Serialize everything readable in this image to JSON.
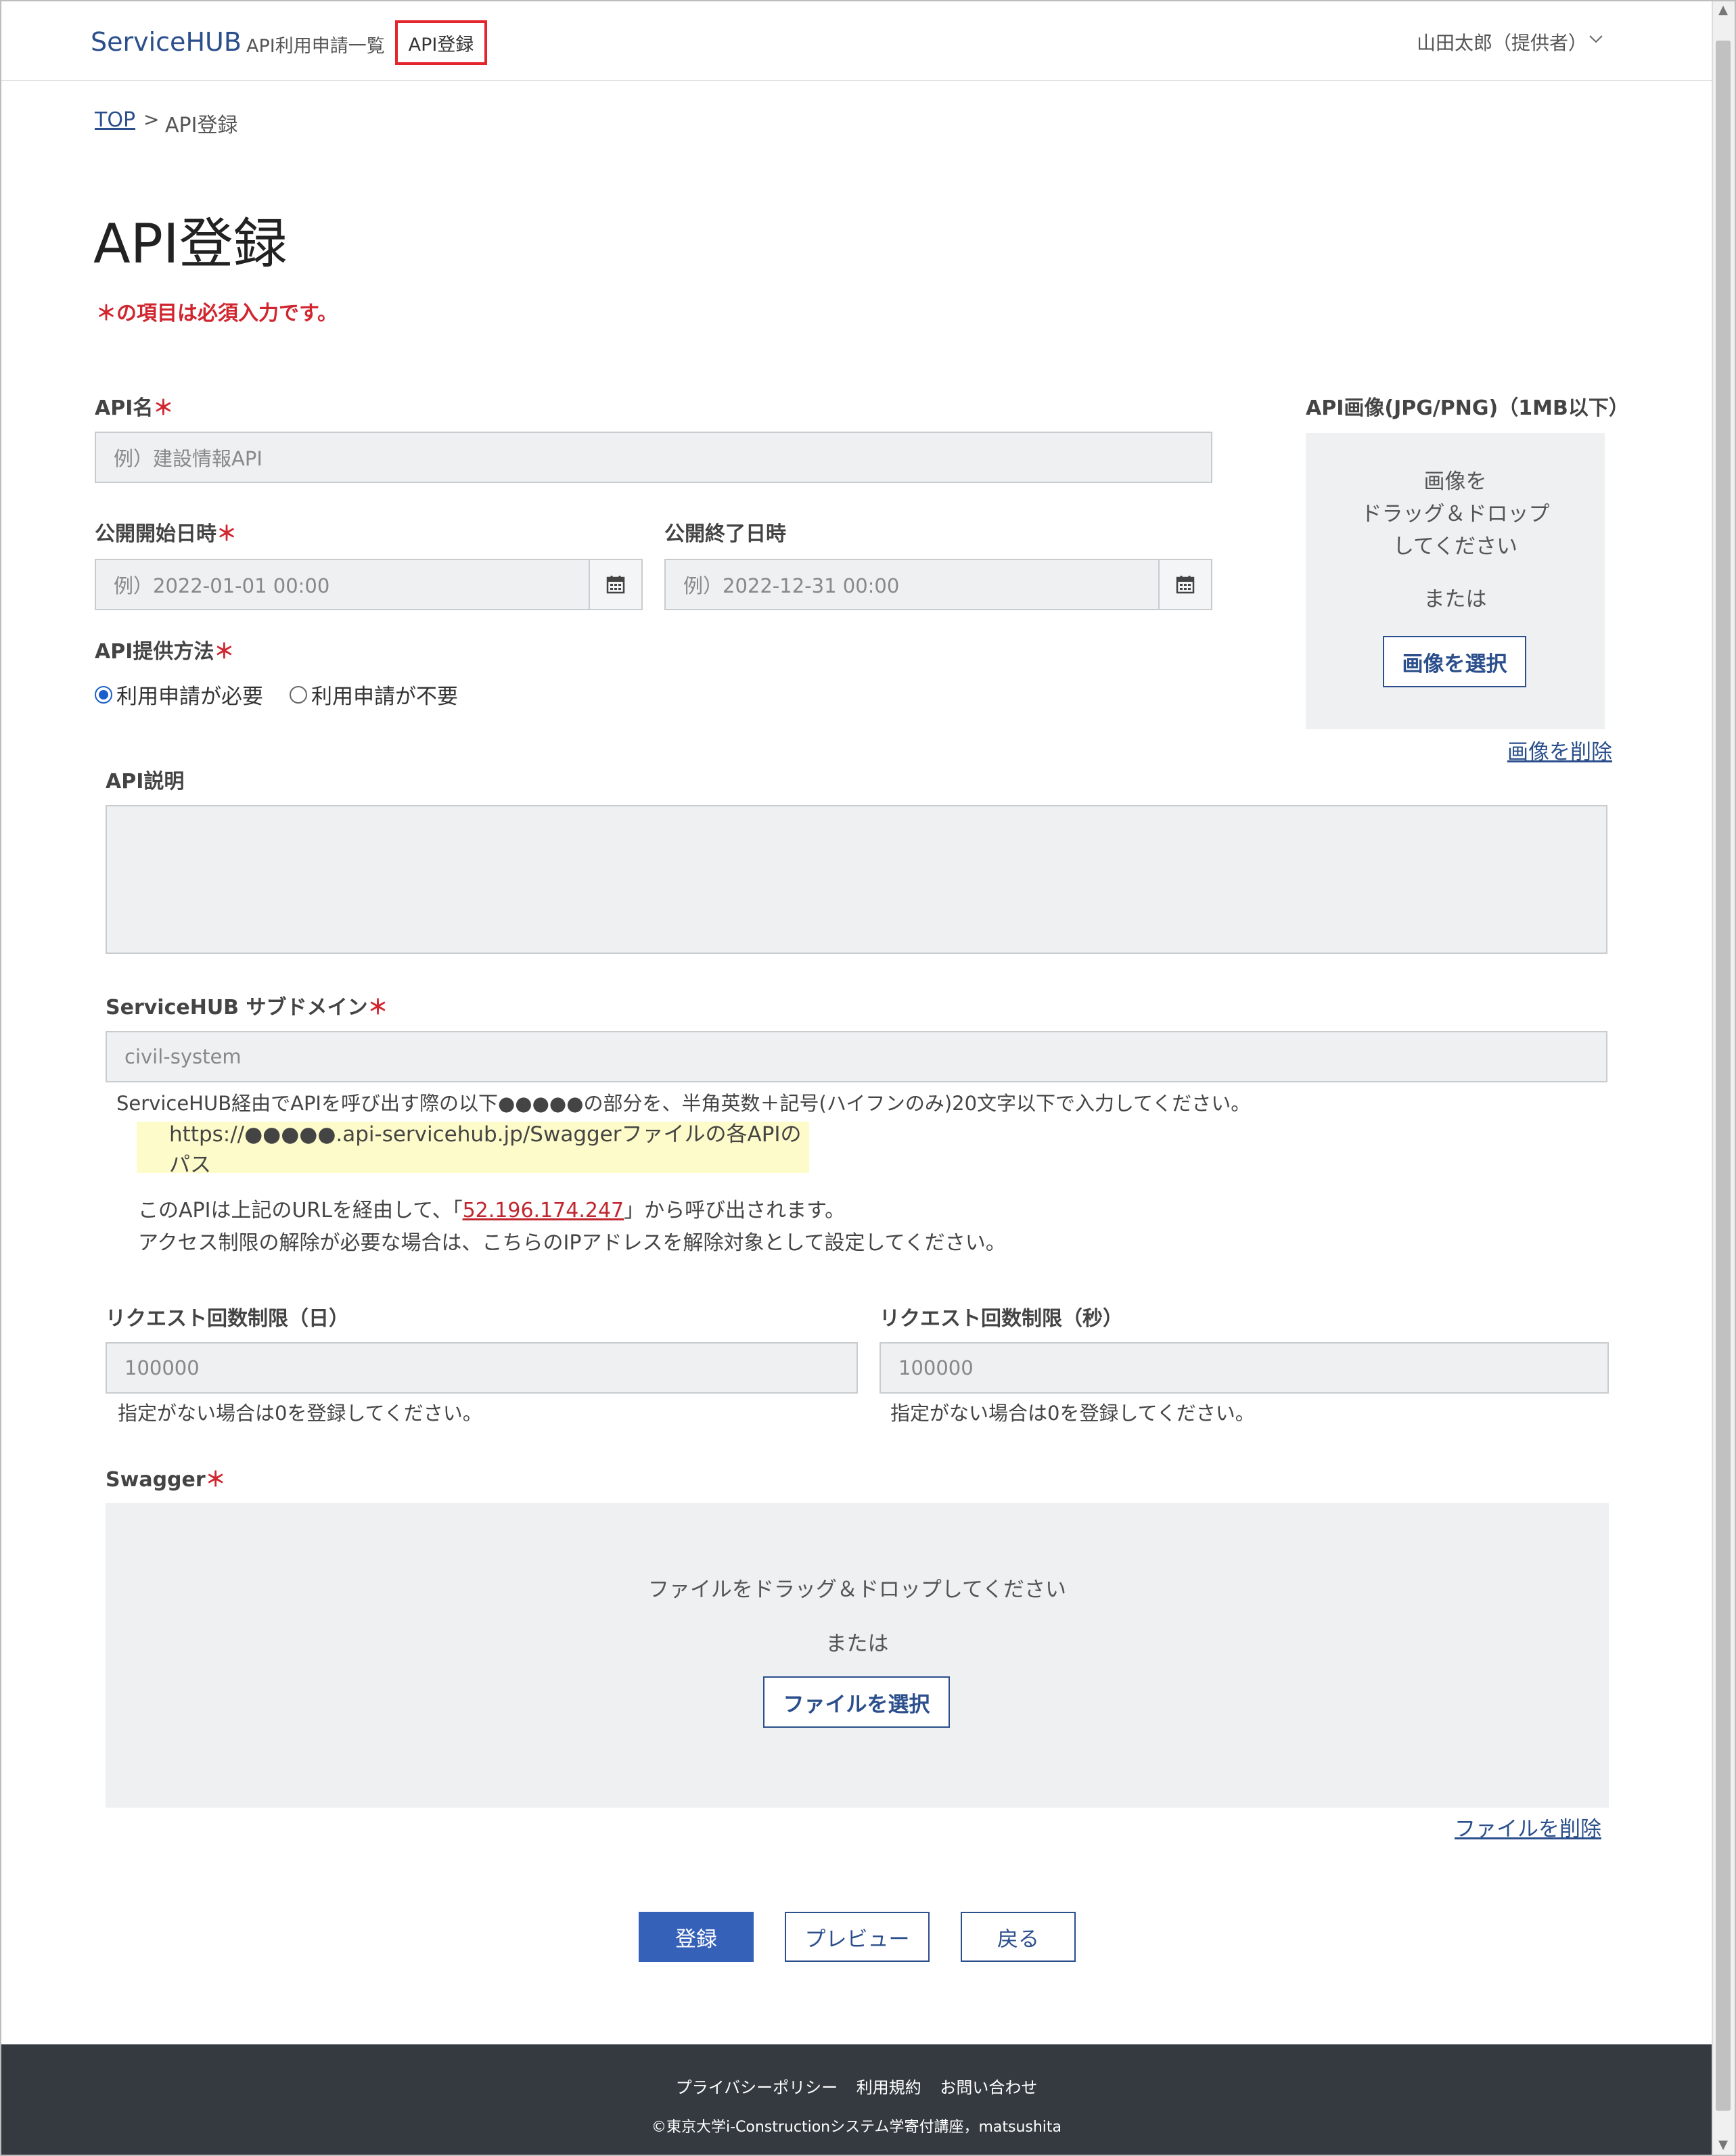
{
  "header": {
    "brand": "ServiceHUB",
    "nav": [
      "API利用申請一覧",
      "API登録"
    ],
    "user": "山田太郎（提供者）"
  },
  "breadcrumb": {
    "top": "TOP",
    "sep": ">",
    "current": "API登録"
  },
  "page": {
    "title": "API登録",
    "required_note": "＊の項目は必須入力です。"
  },
  "form": {
    "api_name": {
      "label": "API名",
      "placeholder": "例）建設情報API"
    },
    "start_date": {
      "label": "公開開始日時",
      "placeholder": "例）2022-01-01 00:00"
    },
    "end_date": {
      "label": "公開終了日時",
      "placeholder": "例）2022-12-31 00:00"
    },
    "provide_method": {
      "label": "API提供方法",
      "options": [
        "利用申請が必要",
        "利用申請が不要"
      ],
      "selected": "利用申請が必要"
    },
    "image": {
      "label": "API画像(JPG/PNG)（1MB以下）",
      "drop_line1": "画像を",
      "drop_line2": "ドラッグ＆ドロップ",
      "drop_line3": "してください",
      "or": "または",
      "select_button": "画像を選択",
      "delete_link": "画像を削除"
    },
    "description": {
      "label": "API説明"
    },
    "subdomain": {
      "label": "ServiceHUB サブドメイン",
      "placeholder": "civil-system",
      "help": "ServiceHUB経由でAPIを呼び出す際の以下●●●●●の部分を、半角英数＋記号(ハイフンのみ)20文字以下で入力してください。",
      "url_example": "https://●●●●●.api-servicehub.jp/Swaggerファイルの各APIのパス",
      "ip_line_prefix": "このAPIは上記のURLを経由して、「",
      "ip": "52.196.174.247",
      "ip_line_suffix": "」から呼び出されます。",
      "ip_line2": "アクセス制限の解除が必要な場合は、こちらのIPアドレスを解除対象として設定してください。"
    },
    "limit_day": {
      "label": "リクエスト回数制限（日）",
      "placeholder": "100000",
      "help": "指定がない場合は0を登録してください。"
    },
    "limit_sec": {
      "label": "リクエスト回数制限（秒）",
      "placeholder": "100000",
      "help": "指定がない場合は0を登録してください。"
    },
    "swagger": {
      "label": "Swagger",
      "drop_text": "ファイルをドラッグ＆ドロップしてください",
      "or": "または",
      "select_button": "ファイルを選択",
      "delete_link": "ファイルを削除"
    },
    "required_mark": "＊"
  },
  "actions": {
    "submit": "登録",
    "preview": "プレビュー",
    "back": "戻る"
  },
  "footer": {
    "links": [
      "プライバシーポリシー",
      "利用規約",
      "お問い合わせ"
    ],
    "copyright": "©東京大学i-Constructionシステム学寄付講座，matsushita"
  },
  "colors": {
    "brand": "#2b4f8c",
    "required": "#d0262f",
    "primary_button": "#3561b8",
    "footer_bg": "#343a40"
  }
}
